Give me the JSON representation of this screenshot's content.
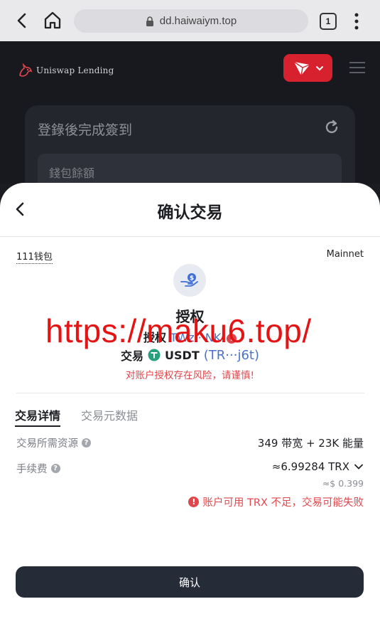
{
  "browser": {
    "url": "dd.haiwaiym.top",
    "tab_count": "1"
  },
  "app": {
    "logo_text": "Uniswap Lending",
    "card_title": "登錄後完成簽到",
    "card_inner_label": "錢包餘額",
    "tron_color": "#d8212f"
  },
  "sheet": {
    "title": "确认交易",
    "wallet_name": "111钱包",
    "network": "Mainnet",
    "auth_title": "授权",
    "auth_row_label": "授权",
    "auth_row_addr": "TWz···NK",
    "auth_warn_glyph": "!",
    "trade_label": "交易",
    "trade_token": "USDT",
    "trade_addr": "(TR···j6t)",
    "risk_text": "对账户授权存在风险，请谨慎!",
    "tabs": [
      {
        "label": "交易详情",
        "active": true
      },
      {
        "label": "交易元数据",
        "active": false
      }
    ],
    "resource_label": "交易所需资源",
    "resource_value": "349 带宽 + 23K 能量",
    "fee_label": "手续费",
    "fee_value": "≈6.99284 TRX",
    "fee_usd": "≈$ 0.399",
    "fee_warning": "账户可用 TRX 不足，交易可能失败",
    "confirm_label": "确认",
    "q_glyph": "?",
    "warn_glyph": "!"
  },
  "watermark": "https://maku6.top/",
  "colors": {
    "accent_blue": "#4a72c9",
    "danger_red": "#e0474c",
    "button_dark": "#262b38",
    "tether_green": "#26a17b"
  }
}
